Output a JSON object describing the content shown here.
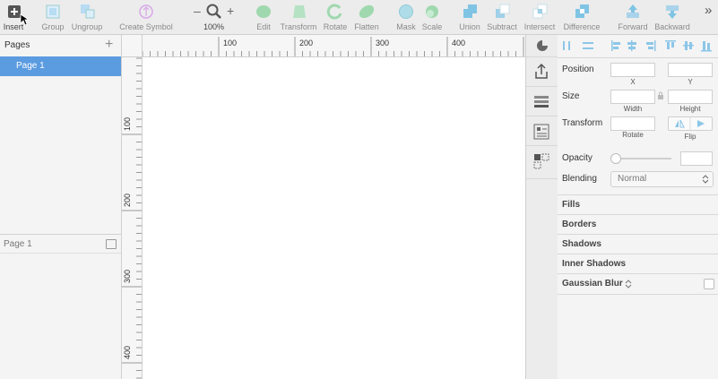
{
  "toolbar": {
    "insert": "Insert",
    "group": "Group",
    "ungroup": "Ungroup",
    "create_symbol": "Create Symbol",
    "zoom_minus": "–",
    "zoom_plus": "+",
    "zoom_level": "100%",
    "edit": "Edit",
    "transform": "Transform",
    "rotate": "Rotate",
    "flatten": "Flatten",
    "mask": "Mask",
    "scale": "Scale",
    "union": "Union",
    "subtract": "Subtract",
    "intersect": "Intersect",
    "difference": "Difference",
    "forward": "Forward",
    "backward": "Backward",
    "more": "»"
  },
  "sidebar": {
    "pages_title": "Pages",
    "add_symbol": "+",
    "pages": [
      {
        "label": "Page 1",
        "selected": true
      }
    ],
    "layer_list_title": "Page 1"
  },
  "rulers": {
    "top": [
      "100",
      "200",
      "300",
      "400"
    ],
    "left": [
      "100",
      "200",
      "300",
      "400"
    ]
  },
  "inspector": {
    "position_label": "Position",
    "x_label": "X",
    "y_label": "Y",
    "size_label": "Size",
    "width_label": "Width",
    "height_label": "Height",
    "transform_label": "Transform",
    "rotate_label": "Rotate",
    "flip_label": "Flip",
    "opacity_label": "Opacity",
    "blending_label": "Blending",
    "blending_value": "Normal",
    "sections": [
      "Fills",
      "Borders",
      "Shadows",
      "Inner Shadows",
      "Gaussian Blur"
    ]
  },
  "colors": {
    "accent": "#5b9be0",
    "icon_green": "#7cc79a",
    "icon_blue": "#8cc6e8",
    "icon_purple": "#d8a8e8"
  }
}
